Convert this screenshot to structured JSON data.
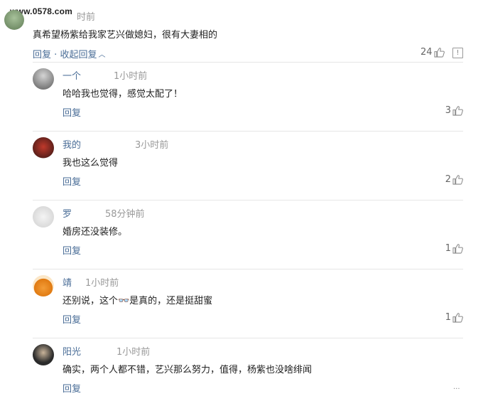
{
  "watermark": "www.0578.com",
  "main_comment": {
    "time": "时前",
    "text": "真希望杨紫给我家艺兴做媳妇，很有大妻相的",
    "reply_label": "回复",
    "separator": "·",
    "collapse_label": "收起回复",
    "likes": "24"
  },
  "replies": [
    {
      "name": "一个",
      "time": "1小时前",
      "text": "哈哈我也觉得，感觉太配了！",
      "reply_label": "回复",
      "likes": "3"
    },
    {
      "name": "我的",
      "time": "3小时前",
      "text": "我也这么觉得",
      "reply_label": "回复",
      "likes": "2"
    },
    {
      "name": "罗",
      "time": "58分钟前",
      "text": "婚房还没装修。",
      "reply_label": "回复",
      "likes": "1"
    },
    {
      "name": "靖",
      "time": "1小时前",
      "text": "还别说，这个👓是真的，还是挺甜蜜",
      "reply_label": "回复",
      "likes": "1"
    },
    {
      "name": "阳光",
      "time": "1小时前",
      "text": "确实，两个人都不错，艺兴那么努力，值得，杨紫也没啥绯闻",
      "reply_label": "回复",
      "likes": ""
    }
  ],
  "icons": {
    "like": "thumbs-up-icon",
    "report": "report-icon"
  }
}
